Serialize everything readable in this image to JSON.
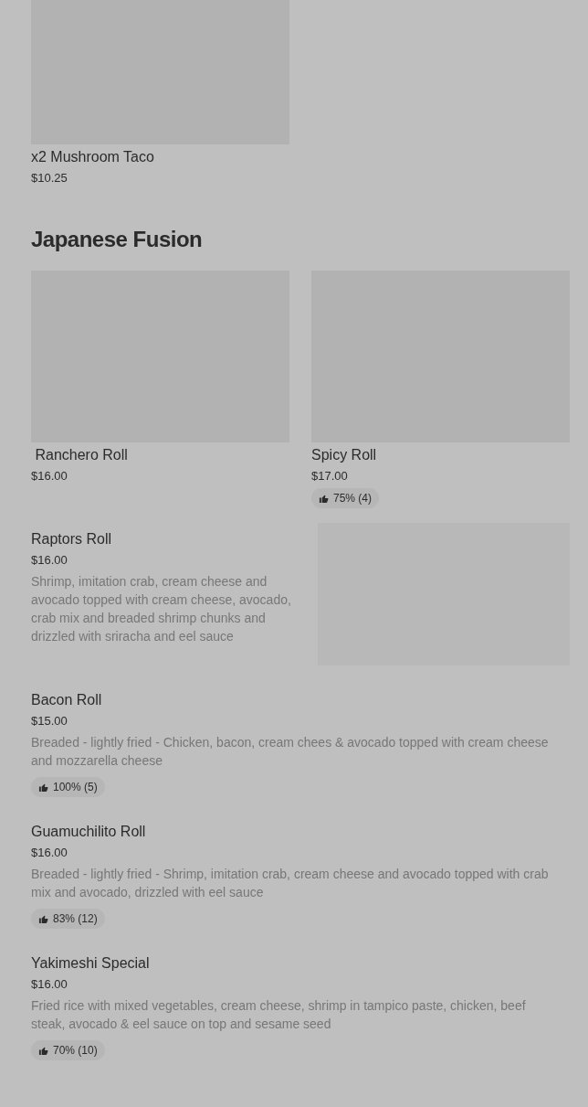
{
  "top_cards": [
    {
      "title": "x2 Mushroom Taco",
      "price": "$10.25"
    }
  ],
  "section": {
    "heading": "Japanese Fusion",
    "cards": [
      {
        "title": " Ranchero Roll",
        "price": "$16.00"
      },
      {
        "title": "Spicy Roll",
        "price": "$17.00",
        "rating": "75% (4)"
      }
    ],
    "items": [
      {
        "title": "Raptors Roll",
        "price": "$16.00",
        "description": "Shrimp, imitation crab, cream cheese and avocado topped with cream cheese, avocado, crab mix and breaded shrimp chunks and drizzled with sriracha and eel sauce",
        "kind": "image"
      },
      {
        "title": "Bacon Roll",
        "price": "$15.00",
        "description": "Breaded - lightly fried - Chicken, bacon, cream chees & avocado topped with cream cheese and mozzarella cheese",
        "rating": "100% (5)",
        "kind": "plain"
      },
      {
        "title": "Guamuchilito Roll",
        "price": "$16.00",
        "description": "Breaded - lightly fried - Shrimp, imitation crab, cream cheese and avocado topped with crab mix and avocado, drizzled with eel sauce",
        "rating": "83% (12)",
        "kind": "plain"
      },
      {
        "title": "Yakimeshi Special",
        "price": "$16.00",
        "description": "Fried rice with mixed vegetables, cream cheese, shrimp in tampico paste, chicken, beef steak, avocado & eel sauce on top and sesame seed",
        "rating": "70% (10)",
        "kind": "plain"
      }
    ]
  }
}
